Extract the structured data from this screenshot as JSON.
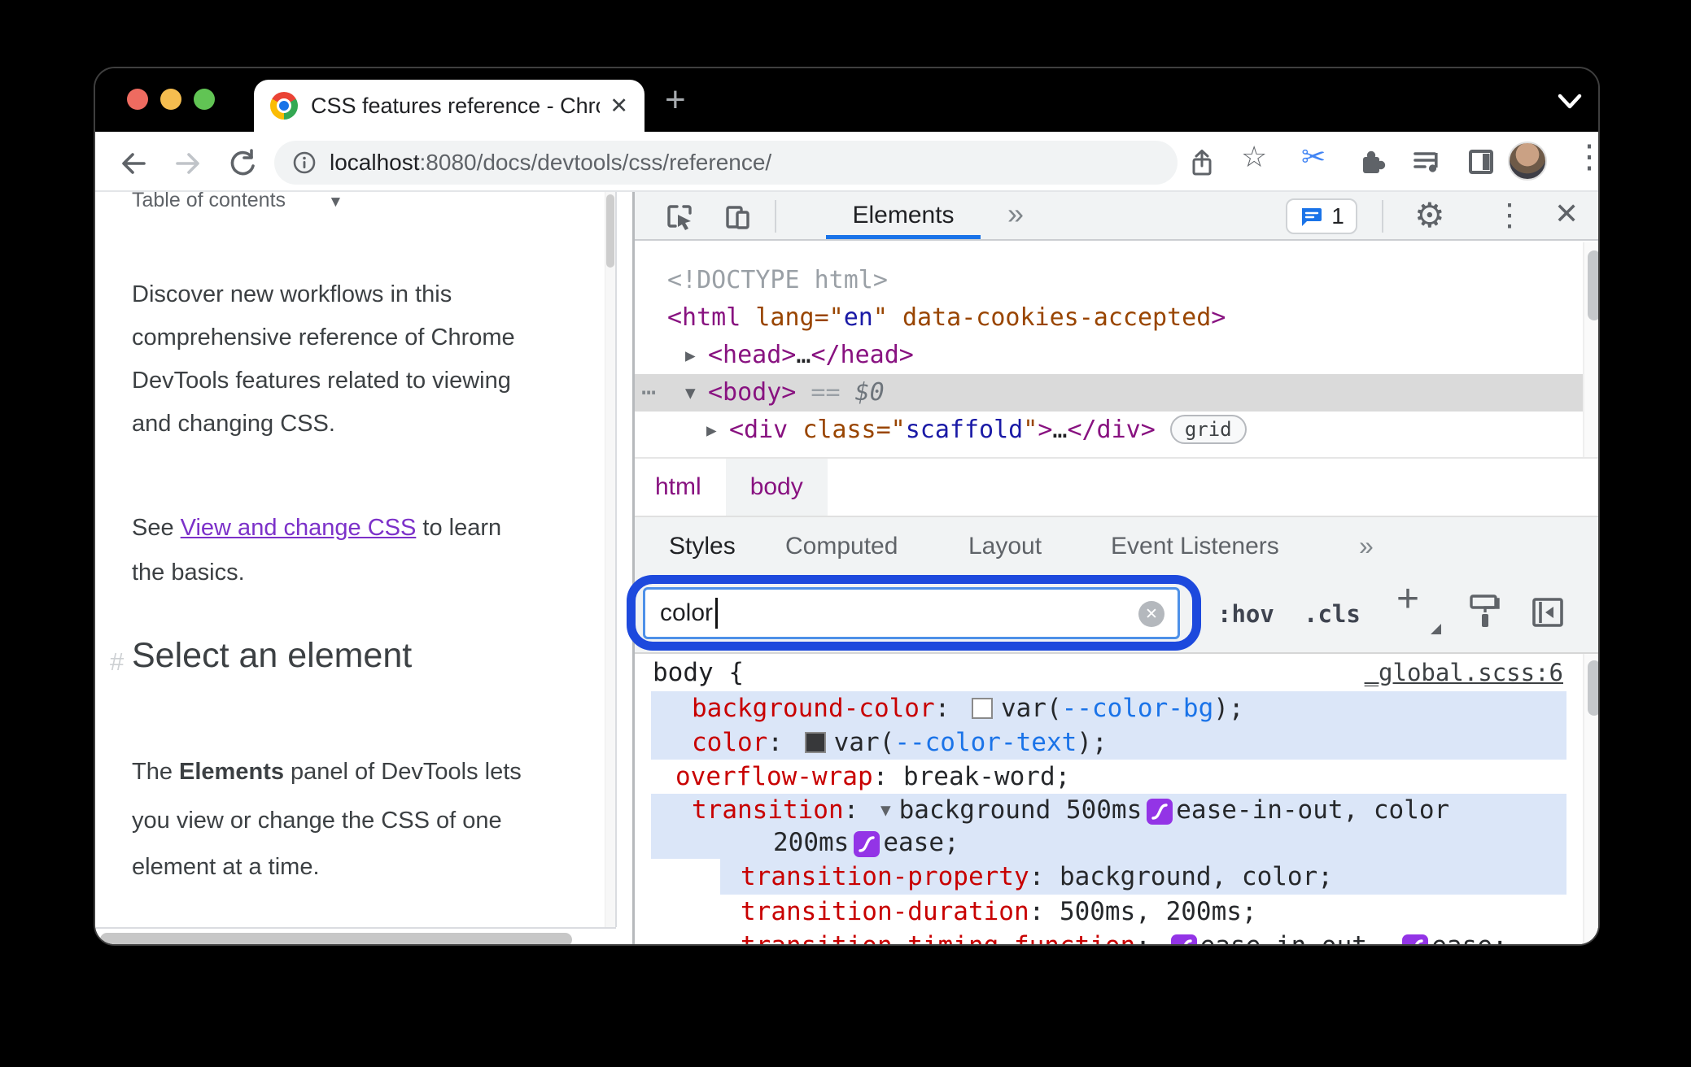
{
  "chrome": {
    "tab_title": "CSS features reference - Chrom",
    "new_tab": "+",
    "url": {
      "host": "localhost",
      "rest": ":8080/docs/devtools/css/reference/"
    }
  },
  "page": {
    "toc_label": "Table of contents",
    "intro": [
      "Discover new workflows in this",
      "comprehensive reference of Chrome",
      "DevTools features related to viewing",
      "and changing CSS."
    ],
    "see": {
      "pre": "See ",
      "link": "View and change CSS",
      "post": " to learn",
      "line2": "the basics."
    },
    "heading": {
      "hash": "#",
      "text": "Select an element"
    },
    "para2": {
      "pre": "The ",
      "bold": "Elements",
      "post": " panel of DevTools lets",
      "line2": "you view or change the CSS of one",
      "line3": "element at a time."
    }
  },
  "devtools": {
    "toolbar": {
      "tab": "Elements",
      "more": "»",
      "chat_count": "1"
    },
    "dom": {
      "doctype": "<!DOCTYPE html>",
      "html": {
        "o": "<html ",
        "a1": "lang",
        "q1": "=\"",
        "v": "en",
        "q2": "\"",
        "a2": " data-cookies-accepted",
        "c": ">"
      },
      "head": {
        "o": "<head>",
        "d": "…",
        "c": "</head>"
      },
      "body": {
        "tag": "<body>",
        "eq": " == ",
        "dollar": "$0"
      },
      "div": {
        "o": "<div ",
        "a": "class",
        "q1": "=\"",
        "v": "scaffold",
        "q2": "\"",
        "b": ">",
        "d": "…",
        "c": "</div>",
        "badge": "grid"
      }
    },
    "crumbs": {
      "html": "html",
      "body": "body"
    },
    "tabs": [
      "Styles",
      "Computed",
      "Layout",
      "Event Listeners"
    ],
    "tabs_more": "»",
    "filter": {
      "value": "color"
    },
    "controls": {
      "pseudo": ":hov",
      "cls": ".cls",
      "plus": "+"
    },
    "styles": {
      "selector": "body {",
      "source": "_global.scss:6",
      "colon": ": ",
      "bg": {
        "name": "background-color",
        "pre": "var(",
        "link": "--color-bg",
        "post": ");"
      },
      "color": {
        "name": "color",
        "pre": "var(",
        "link": "--color-text",
        "post": ");"
      },
      "overflow": {
        "name": "overflow-wrap",
        "value": "break-word;"
      },
      "transition": {
        "name": "transition",
        "seg1": "background 500ms",
        "seg2": "ease-in-out, color",
        "seg3": "200ms",
        "seg4": "ease;"
      },
      "tprop": {
        "name": "transition-property",
        "value": "background, color;"
      },
      "tdur": {
        "name": "transition-duration",
        "value": "500ms, 200ms;"
      },
      "ttf": {
        "name": "transition-timing-function",
        "seg1": "ease-in-out, ",
        "seg2": "ease;"
      }
    }
  },
  "glyphs": {
    "caret_right": "▶",
    "caret_down": "▼",
    "more_h": "⋯",
    "gear": "⚙",
    "kebab": "⋮",
    "close": "✕",
    "close_small": "✕",
    "star": "☆",
    "scissors": "✂",
    "toc_caret": "▼"
  },
  "colors": {
    "accent_blue": "#1a73e8",
    "highlight_ring": "#1d49dd",
    "match_highlight": "#dbe6f8",
    "tag_purple": "#881280",
    "attr_orange": "#994500",
    "attr_value_blue": "#1a1aa6",
    "property_red": "#c80000",
    "link_purple": "#7c31c9",
    "bezier_purple": "#9334e6"
  }
}
